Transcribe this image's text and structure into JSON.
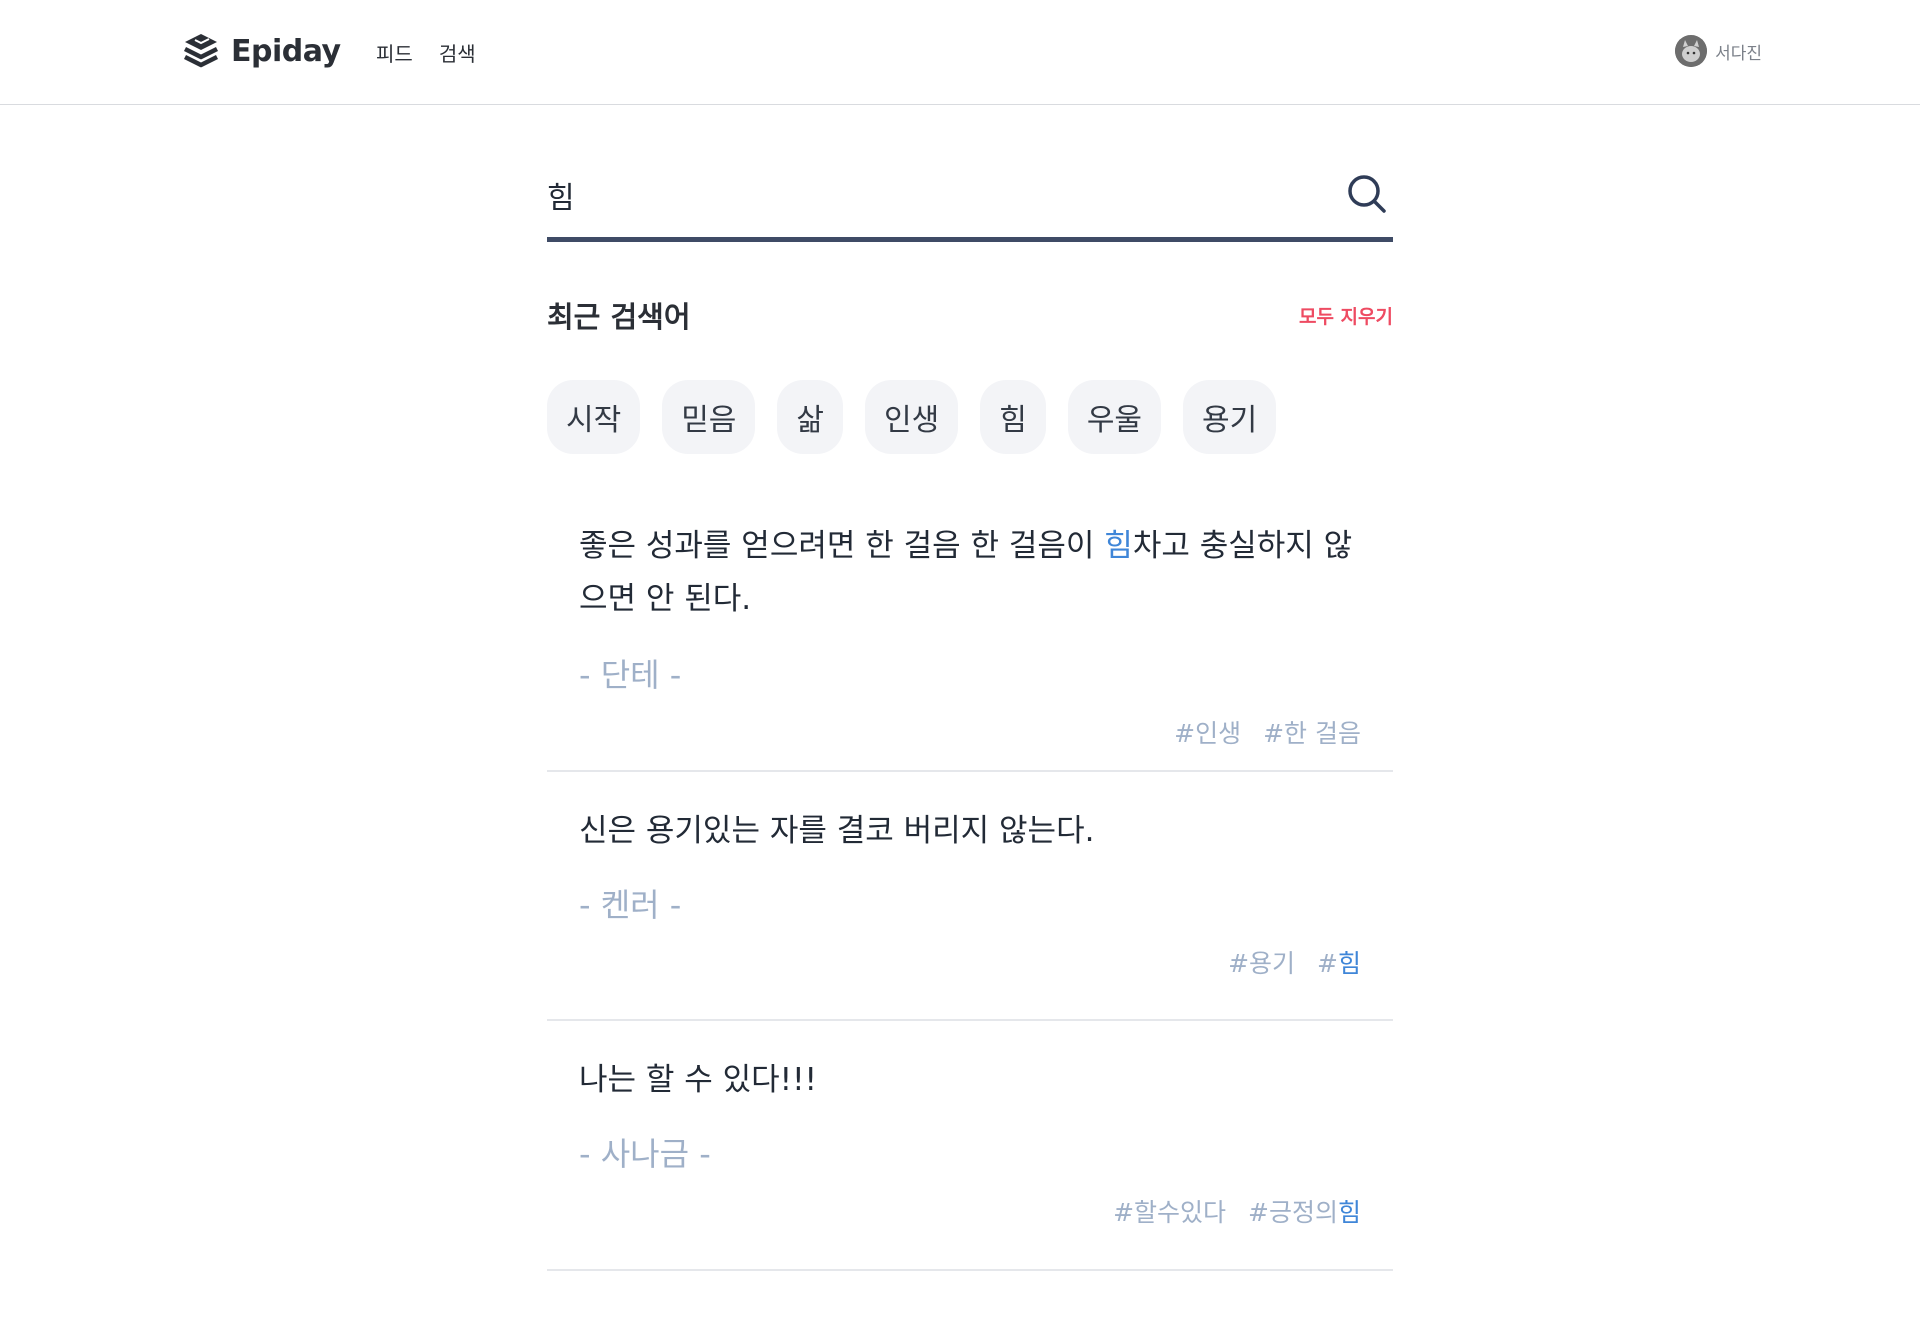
{
  "header": {
    "logo_text": "Epiday",
    "nav": [
      "피드",
      "검색"
    ],
    "user_name": "서다진"
  },
  "search": {
    "value": "힘",
    "placeholder": ""
  },
  "recent": {
    "title": "최근 검색어",
    "clear_label": "모두 지우기",
    "chips": [
      "시작",
      "믿음",
      "삶",
      "인생",
      "힘",
      "우울",
      "용기"
    ]
  },
  "quotes": [
    {
      "text_before": "좋은 성과를 얻으려면 한 걸음 한 걸음이 ",
      "highlight": "힘",
      "text_after": "차고 충실하지 않으면 안 된다.",
      "author": "- 단테 -",
      "tags": [
        {
          "prefix": "#인생",
          "highlight": ""
        },
        {
          "prefix": "#한 걸음",
          "highlight": ""
        }
      ]
    },
    {
      "text_before": "신은 용기있는 자를 결코 버리지 않는다.",
      "highlight": "",
      "text_after": "",
      "author": "- 켄러 -",
      "tags": [
        {
          "prefix": "#용기",
          "highlight": ""
        },
        {
          "prefix": "#",
          "highlight": "힘"
        }
      ]
    },
    {
      "text_before": "나는 할 수 있다!!!",
      "highlight": "",
      "text_after": "",
      "author": "- 사나금 -",
      "tags": [
        {
          "prefix": "#할수있다",
          "highlight": ""
        },
        {
          "prefix": "#긍정의",
          "highlight": "힘"
        }
      ]
    }
  ],
  "colors": {
    "accent_underline": "#3f4b66",
    "highlight": "#3f86d8",
    "clear_red": "#ee4b62",
    "muted": "#9fb0c8"
  },
  "icons": {
    "logo": "layers-icon",
    "search": "search-icon"
  }
}
